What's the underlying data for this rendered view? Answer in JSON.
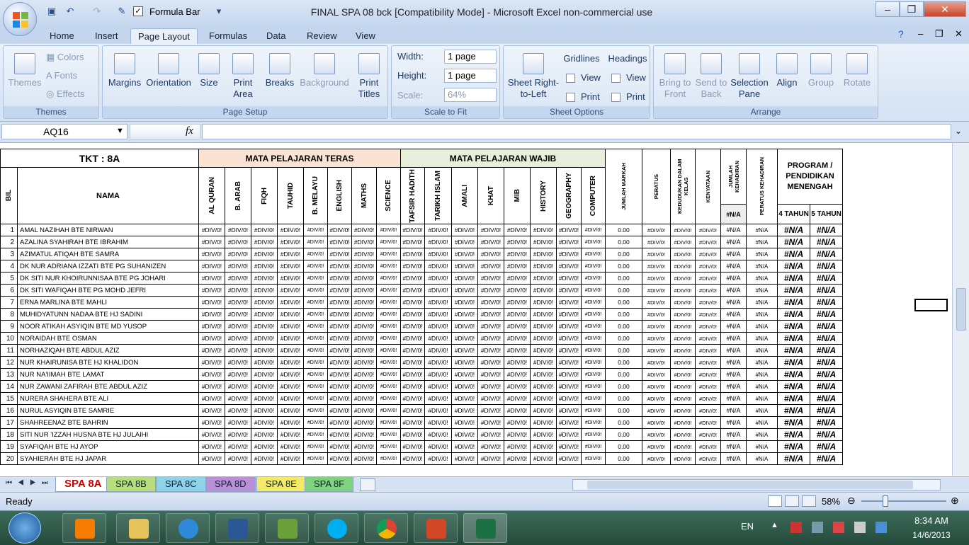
{
  "window": {
    "title": "FINAL SPA 08 bck  [Compatibility Mode] - Microsoft Excel non-commercial use",
    "qa_formula_bar": "Formula Bar",
    "qa_checkmark": "✓"
  },
  "ribbon_tabs": [
    "Home",
    "Insert",
    "Page Layout",
    "Formulas",
    "Data",
    "Review",
    "View"
  ],
  "active_tab": "Page Layout",
  "ribbon": {
    "themes": {
      "title": "Themes",
      "themes_label": "Themes",
      "colors": "Colors",
      "fonts": "Fonts",
      "effects": "Effects"
    },
    "page_setup": {
      "title": "Page Setup",
      "margins": "Margins",
      "orientation": "Orientation",
      "size": "Size",
      "print_area": "Print Area",
      "breaks": "Breaks",
      "background": "Background",
      "print_titles": "Print Titles"
    },
    "scale_to_fit": {
      "title": "Scale to Fit",
      "width_label": "Width:",
      "width_value": "1 page",
      "height_label": "Height:",
      "height_value": "1 page",
      "scale_label": "Scale:",
      "scale_value": "64%"
    },
    "sheet_options": {
      "title": "Sheet Options",
      "sheet_rtl": "Sheet Right-to-Left",
      "gridlines": "Gridlines",
      "headings": "Headings",
      "view": "View",
      "print": "Print"
    },
    "arrange": {
      "title": "Arrange",
      "bring_to_front": "Bring to Front",
      "send_to_back": "Send to Back",
      "selection_pane": "Selection Pane",
      "align": "Align",
      "group": "Group",
      "rotate": "Rotate"
    }
  },
  "formula_bar": {
    "name_box": "AQ16",
    "fx": "fx",
    "content": ""
  },
  "sheet": {
    "tkt": "TKT :  8A",
    "teras_header": "MATA  PELAJARAN  TERAS",
    "wajib_header": "MATA  PELAJARAN  WAJIB",
    "bil": "BIL",
    "nama": "NAMA",
    "subjects_teras": [
      "AL QURAN",
      "B. ARAB",
      "FIQH",
      "TAUHID",
      "B. MELAYU",
      "ENGLISH",
      "MATHS",
      "SCIENCE"
    ],
    "subjects_wajib": [
      "TAFSIR HADITH",
      "TARIKH ISLAM",
      "AMALI",
      "KHAT",
      "MIB",
      "HISTORY",
      "GEOGRAPHY",
      "COMPUTER"
    ],
    "extra_cols": [
      "JUMLAH MARKAH",
      "PERATUS",
      "KEDUDUKAN DALAM KELAS",
      "KENYATAAN",
      "JUMLAH KEHADIRAN",
      "PERATUS KEHADIRAN"
    ],
    "kehadiran_value": "#N/A",
    "program_header": "PROGRAM / PENDIDIKAN MENENGAH",
    "program_cols": [
      "4 TAHUN",
      "5 TAHUN"
    ],
    "div_error": "#DIV/0!",
    "na_error": "#N/A",
    "na_small": "#N/A",
    "markah_value": "0.00",
    "students": [
      "AMAL NAZIHAH BTE NIRWAN",
      "AZALINA SYAHIRAH BTE IBRAHIM",
      "AZIMATUL ATIQAH BTE SAMRA",
      "DK NUR ADRIANA IZZATI BTE PG SUHANIZEN",
      "DK SITI NUR KHOIRUNNISAA BTE PG JOHARI",
      "DK SITI WAFIQAH BTE PG MOHD JEFRI",
      "ERNA MARLINA BTE MAHLI",
      "MUHIDYATUNN NADAA BTE HJ SADINI",
      "NOOR ATIKAH ASYIQIN BTE MD YUSOP",
      "NORAIDAH BTE OSMAN",
      "NORHAZIQAH BTE ABDUL AZIZ",
      "NUR KHAIRUNISA BTE HJ KHALIDON",
      "NUR NA'IIMAH BTE LAMAT",
      "NUR ZAWANI ZAFIRAH BTE ABDUL AZIZ",
      "NURERA SHAHERA BTE ALI",
      "NURUL ASYIQIN BTE SAMRIE",
      "SHAHREENAZ BTE BAHRIN",
      "SITI NUR 'IZZAH HUSNA BTE HJ JULAIHI",
      "SYAFIQAH BTE HJ AYOP",
      "SYAHIERAH BTE HJ JAPAR"
    ]
  },
  "sheet_tabs": [
    {
      "label": "SPA 8A",
      "color": "#ffffff"
    },
    {
      "label": "SPA 8B",
      "color": "#b7dd7e"
    },
    {
      "label": "SPA 8C",
      "color": "#8fd3e8"
    },
    {
      "label": "SPA 8D",
      "color": "#b98fd8"
    },
    {
      "label": "SPA 8E",
      "color": "#f3ea6a"
    },
    {
      "label": "SPA 8F",
      "color": "#7fd37f"
    }
  ],
  "status": {
    "ready": "Ready",
    "zoom": "58%"
  },
  "taskbar": {
    "lang": "EN",
    "time": "8:34 AM",
    "date": "14/6/2013"
  }
}
